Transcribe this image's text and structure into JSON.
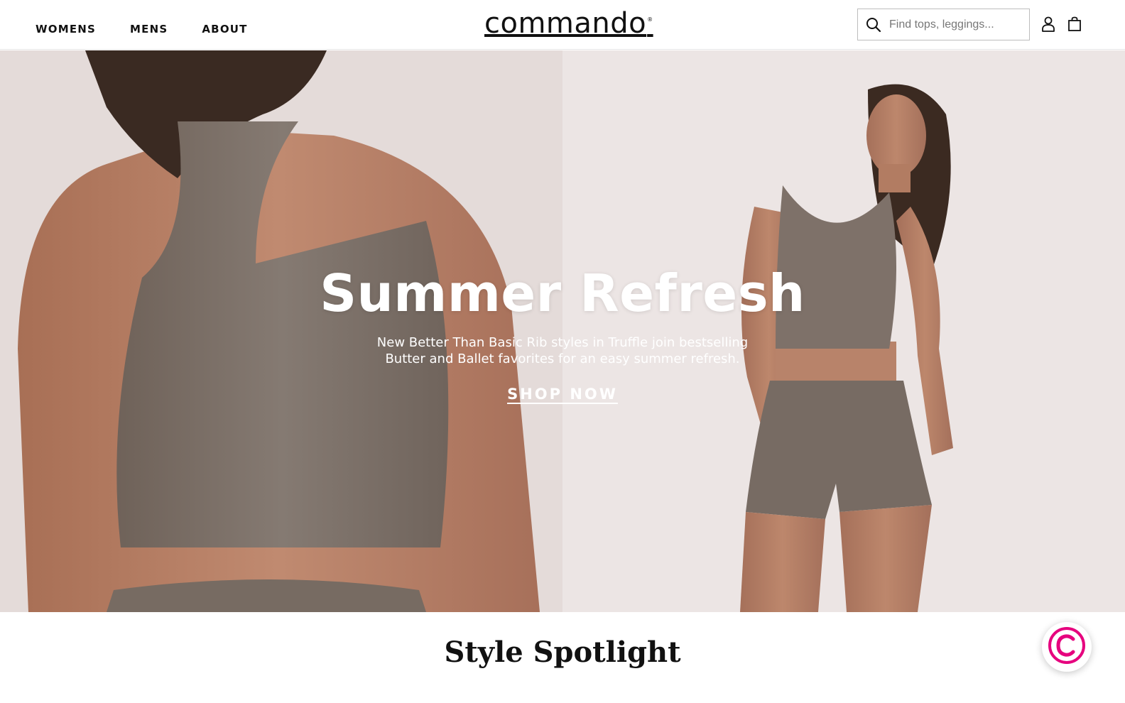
{
  "nav": {
    "items": [
      "WOMENS",
      "MENS",
      "ABOUT"
    ]
  },
  "brand": {
    "logo_text": "commando",
    "mark": "®"
  },
  "search": {
    "placeholder": "Find tops, leggings...",
    "icon": "search-icon"
  },
  "header_icons": [
    "account-icon",
    "shopping-bag-icon"
  ],
  "hero": {
    "title": "Summer Refresh",
    "subtitle_line1": "New Better Than Basic Rib styles in Truffle join bestselling",
    "subtitle_line2": "Butter and Ballet favorites for an easy summer refresh.",
    "cta": "SHOP NOW"
  },
  "section": {
    "title": "Style Spotlight"
  },
  "chat": {
    "icon": "chat-c-logo-icon",
    "color": "#e6007e"
  },
  "colors": {
    "text": "#111111",
    "hero_text": "#ffffff",
    "garment": "#7b6f66",
    "skin": "#b88468",
    "backdrop": "#e8e0df",
    "accent": "#e6007e"
  }
}
